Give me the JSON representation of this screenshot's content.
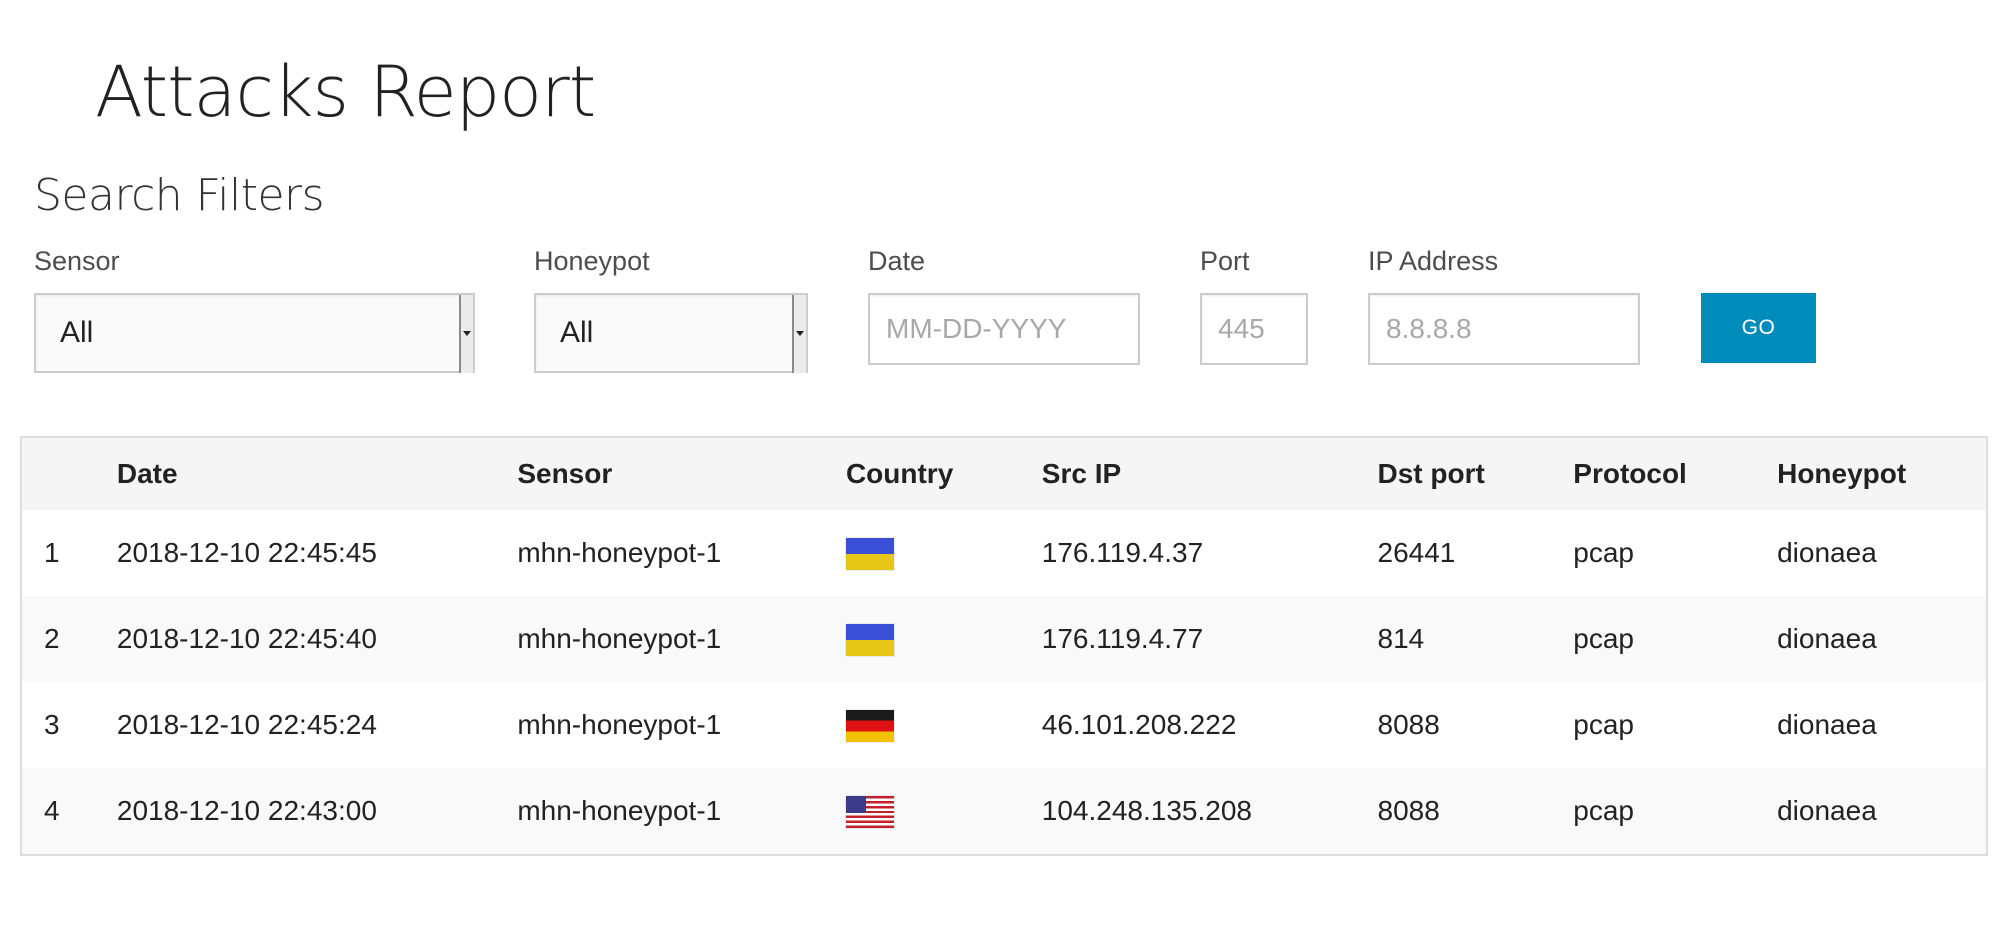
{
  "page": {
    "title": "Attacks Report"
  },
  "filters": {
    "section_title": "Search Filters",
    "sensor": {
      "label": "Sensor",
      "value": "All"
    },
    "honeypot": {
      "label": "Honeypot",
      "value": "All"
    },
    "date": {
      "label": "Date",
      "placeholder": "MM-DD-YYYY"
    },
    "port": {
      "label": "Port",
      "placeholder": "445"
    },
    "ip_address": {
      "label": "IP Address",
      "placeholder": "8.8.8.8"
    },
    "go_label": "GO",
    "go_color": "#008cba"
  },
  "table": {
    "headers": {
      "index": "",
      "date": "Date",
      "sensor": "Sensor",
      "country": "Country",
      "src_ip": "Src IP",
      "dst_port": "Dst port",
      "protocol": "Protocol",
      "honeypot": "Honeypot"
    },
    "rows": [
      {
        "index": "1",
        "date": "2018-12-10 22:45:45",
        "sensor": "mhn-honeypot-1",
        "country_flag": "ua-flag-icon",
        "src_ip": "176.119.4.37",
        "dst_port": "26441",
        "protocol": "pcap",
        "honeypot": "dionaea"
      },
      {
        "index": "2",
        "date": "2018-12-10 22:45:40",
        "sensor": "mhn-honeypot-1",
        "country_flag": "ua-flag-icon",
        "src_ip": "176.119.4.77",
        "dst_port": "814",
        "protocol": "pcap",
        "honeypot": "dionaea"
      },
      {
        "index": "3",
        "date": "2018-12-10 22:45:24",
        "sensor": "mhn-honeypot-1",
        "country_flag": "de-flag-icon",
        "src_ip": "46.101.208.222",
        "dst_port": "8088",
        "protocol": "pcap",
        "honeypot": "dionaea"
      },
      {
        "index": "4",
        "date": "2018-12-10 22:43:00",
        "sensor": "mhn-honeypot-1",
        "country_flag": "us-flag-icon",
        "src_ip": "104.248.135.208",
        "dst_port": "8088",
        "protocol": "pcap",
        "honeypot": "dionaea"
      }
    ]
  }
}
